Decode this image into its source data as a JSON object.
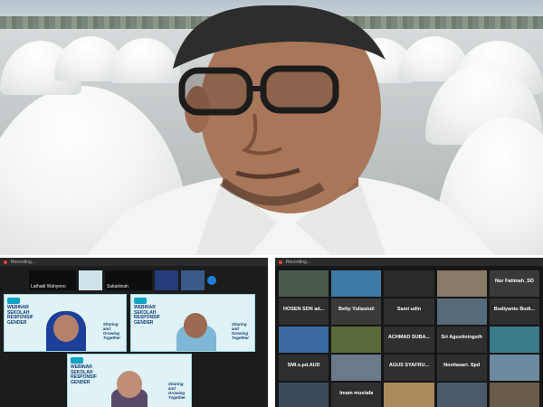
{
  "speaker": {},
  "left_panel": {
    "topbar_label": "Recording...",
    "strip_names": [
      "Lathadi Wahyono",
      "Sukartinah"
    ],
    "webinar": {
      "title_line1": "WEBINAR",
      "title_line2": "SEKOLAH",
      "title_line3": "RESPONSIF",
      "title_line4": "GENDER",
      "tag1": "Sharing",
      "tag2": "and",
      "tag3": "Growing",
      "tag4": "Together"
    }
  },
  "right_panel": {
    "topbar_label": "Recording...",
    "participants": [
      "",
      "",
      "",
      "",
      "Nur Fatimah_SD",
      "HOSEN SDN ad...",
      "Betty Yuliastuti",
      "Sami udin",
      "",
      "Budiyanto Budi...",
      "",
      "",
      "ACHMAD SUBA...",
      "Sri Agustiningsih",
      "",
      "SMI.s.pd.AUD",
      "",
      "AGUS SYAFRU...",
      "Novitasari. Spd",
      "",
      "",
      "Imam mustafa",
      "",
      "",
      ""
    ]
  }
}
